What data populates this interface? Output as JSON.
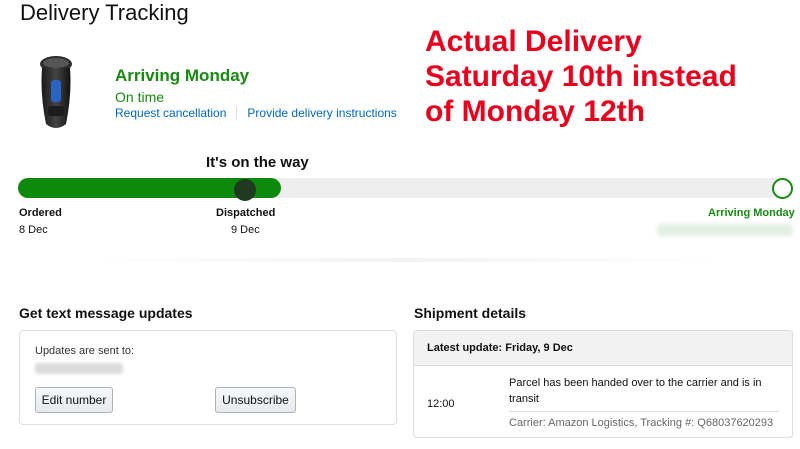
{
  "page": {
    "title": "Delivery Tracking"
  },
  "product": {
    "image_icon": "electric-shaver-icon"
  },
  "status": {
    "heading": "Arriving Monday",
    "subheading": "On time",
    "links": [
      "Request cancellation",
      "Provide delivery instructions"
    ]
  },
  "annotation": {
    "lines": [
      "Actual Delivery",
      "Saturday 10th instead",
      "of Monday 12th"
    ],
    "color": "#e8001c"
  },
  "progress": {
    "caption": "It's on the way",
    "fraction_complete": 0.34,
    "fill_color": "#0d8a0b",
    "steps": [
      {
        "label": "Ordered",
        "date": "8 Dec"
      },
      {
        "label": "Dispatched",
        "date": "9 Dec"
      },
      {
        "label": "Arriving Monday",
        "date": ""
      }
    ]
  },
  "sms": {
    "title": "Get text message updates",
    "caption": "Updates are sent to:",
    "edit_label": "Edit number",
    "unsubscribe_label": "Unsubscribe"
  },
  "shipment": {
    "title": "Shipment details",
    "latest_update": "Latest update: Friday, 9 Dec",
    "time": "12:00",
    "message": "Parcel has been handed over to the carrier and is in transit",
    "carrier": "Carrier: Amazon Logistics, Tracking #: Q68037620293"
  },
  "colors": {
    "success": "#178a12",
    "link": "#0066c0"
  }
}
